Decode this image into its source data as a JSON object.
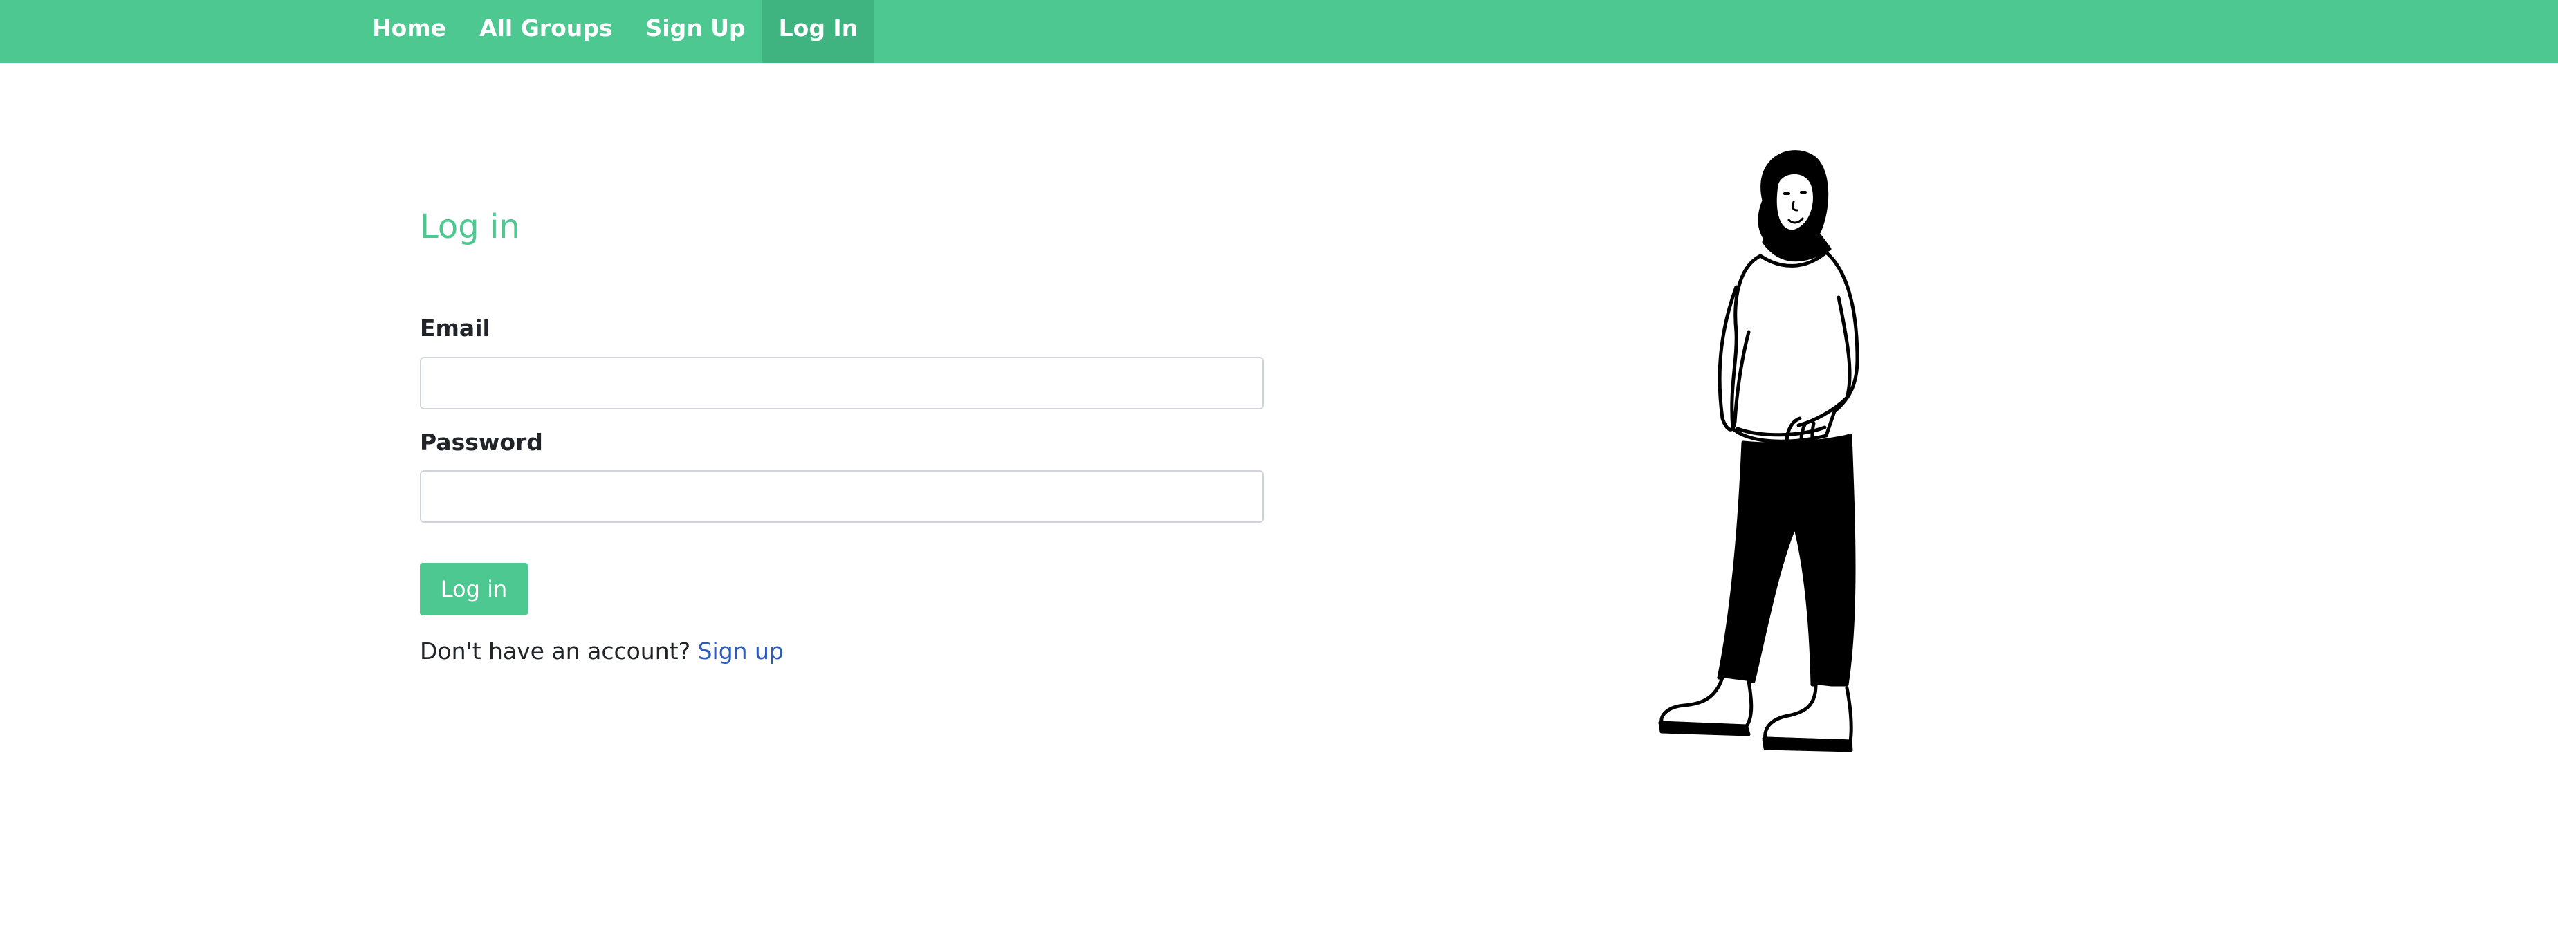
{
  "nav": {
    "items": [
      {
        "label": "Home"
      },
      {
        "label": "All Groups"
      },
      {
        "label": "Sign Up"
      },
      {
        "label": "Log In"
      }
    ],
    "active_index": 3
  },
  "form": {
    "title": "Log in",
    "email": {
      "label": "Email",
      "value": "",
      "placeholder": ""
    },
    "password": {
      "label": "Password",
      "value": "",
      "placeholder": ""
    },
    "submit_label": "Log in",
    "signup_prompt": "Don't have an account?",
    "signup_link": "Sign up"
  },
  "illustration": {
    "icon": "standing-woman-illustration"
  },
  "colors": {
    "accent": "#4dc891",
    "nav_active": "#3fb380",
    "link": "#2d5bb8"
  }
}
